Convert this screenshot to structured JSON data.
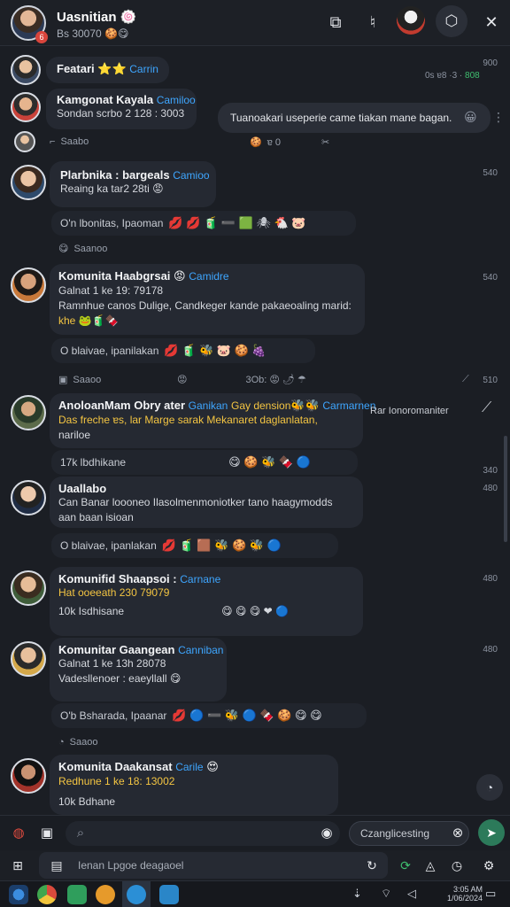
{
  "header": {
    "title": "Uasnitian",
    "title_emoji": "🍥",
    "subtitle": "Bs 30070 🍪😋",
    "badge": "6",
    "icons": [
      "photo-icon",
      "phone-icon",
      "video-icon",
      "close-icon"
    ]
  },
  "top_right": {
    "time": "900",
    "counts": "0s ɐ8 ·3 ·",
    "green_count": "808"
  },
  "messages": [
    {
      "title": "Featari",
      "emoji": "⭐⭐",
      "tag": "Carrin",
      "time": ""
    },
    {
      "title": "Kamgonat Kayala",
      "tag": "Camiloo",
      "line1": "Sondan scrbo 2 128 : 3003",
      "reply_text": "Tuanoakari useperie came tiakan mane bagan.",
      "reply_emoji": "😀",
      "sub": "Saabo",
      "sub_counts": "ɐ 0",
      "sub_icon": "✂"
    },
    {
      "title": "Plarbnika : bargeals",
      "tag": "Camioo",
      "line1": "Reaing ka tar2 28ti",
      "line1_emoji": "😡",
      "reactions_label": "O'n lbonitas, Ipaoman",
      "reactions": "💋 💋 🧃 ➖ 🟩 🕷 🐔 🐷",
      "sub": "Saanoo",
      "time": "540"
    },
    {
      "title": "Komunita Haabgrsai",
      "title_emoji": "😡",
      "tag": "Camidre",
      "line1": "Galnat 1 ke 19: 79178",
      "line2": "Ramnhue canos Dulige, Candkeger kande pakaeoaling marid:",
      "line3": "khe",
      "line3_emoji": "🐸🧃🍫",
      "reactions_label": "O blaivae, ipanilakan",
      "reactions": "💋 🧃 🐝 🐷 🍪 🍇",
      "sub": "Saaoo",
      "sub_middle": "3Ob: 😡 🌶 ☂",
      "time": "540"
    },
    {
      "title": "AnoloanMam Obry ater",
      "tag": "Ganikan",
      "tag2": "Gay dension",
      "tag2_emoji": "🐝🐝",
      "tag3": "Carmarnen",
      "right_text": "Rar Ionoromaniter",
      "line1": "Das freche ɐs, lar Marge sarak Mekanaret daglanlatan,",
      "line2": "nariloe",
      "reactions_label": "17k lbdhikane",
      "reactions": "😋 🍪 🐝 🍫 🔵",
      "time": "340"
    },
    {
      "title": "Uaallabo",
      "line1": "Can Banar loooneo Ilasolmenmoniotker tano haagymodds",
      "line2": "aan baan isioan",
      "reactions_label": "O blaivae, ipanlakan",
      "reactions": "💋 🧃 🟫 🐝 🍪 🐝 🔵",
      "time": "480"
    },
    {
      "title": "Komunifid Shaapsoi :",
      "tag": "Carnane",
      "line1": "Hat ooeeath 230 79079",
      "reactions_label": "10k Isdhisane",
      "reactions": "😋 😋 😋 ❤ 🔵",
      "time": "480"
    },
    {
      "title": "Komunitar Gaangean",
      "tag": "Canniban",
      "line1": "Galnat 1 ke 13h 28078",
      "line2": "Vadesllenoer : eaeyllall",
      "line2_emoji": "😋",
      "reactions_label": "O'b Bsharada, Ipaanar",
      "reactions": "💋 🔵 ➖ 🐝 🔵 🍫 🍪 😋 😋",
      "sub": "Saaoo",
      "time": "480"
    },
    {
      "title": "Komunita Daakansat",
      "tag": "Carile",
      "title_emoji": "😍",
      "line1": "Redhune 1 ke 18: 13002",
      "reactions_label": "10k Bdhane",
      "time": ""
    }
  ],
  "composer": {
    "input_placeholder": "",
    "chip_label": "Czanglicesting",
    "send_icon": "send-icon"
  },
  "search": {
    "placeholder": "Ienan Lpgoe deagaoel"
  },
  "taskbar": {
    "clock_time": "3:05 AM",
    "clock_date": "1/06/2024"
  },
  "colors": {
    "background": "#1b1e24",
    "bubble": "#252932",
    "tag_blue": "#3ea6ff",
    "accent_yellow": "#f4c542",
    "send_green": "#2c7a5a"
  }
}
